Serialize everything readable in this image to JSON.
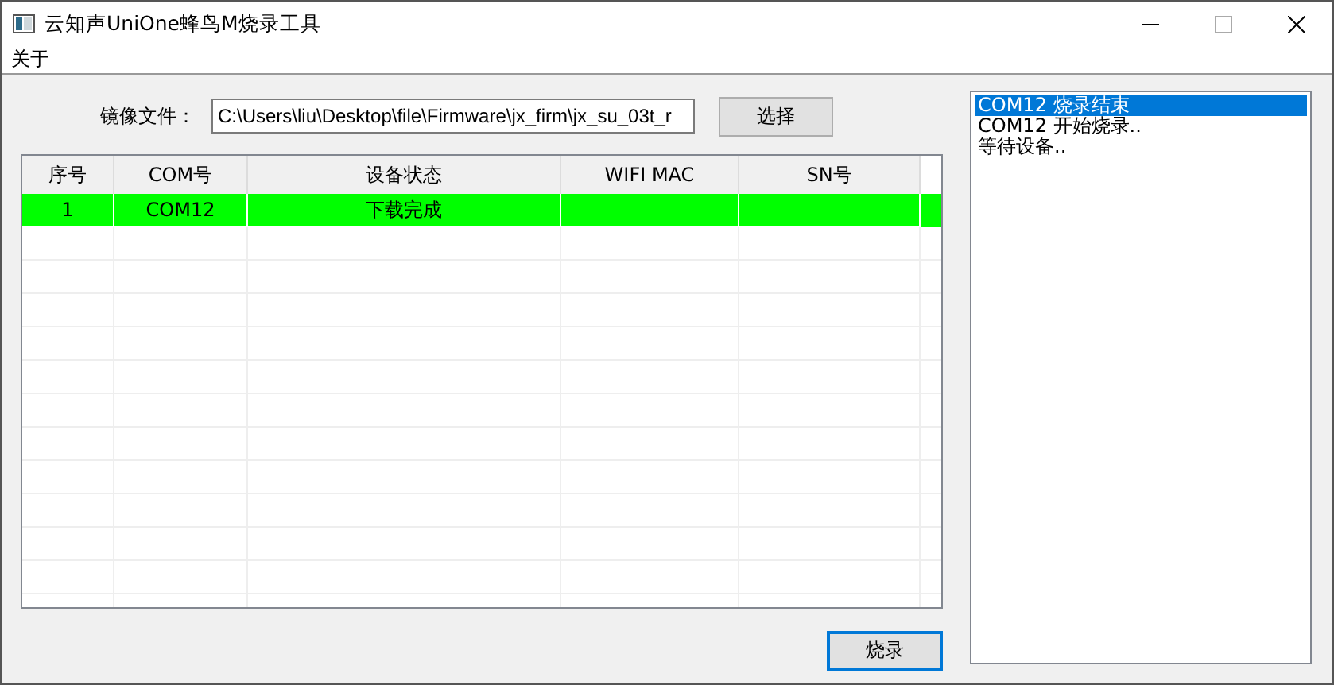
{
  "window": {
    "title": "云知声UniOne蜂鸟M烧录工具"
  },
  "menu": [
    "关于"
  ],
  "image_file": {
    "label": "镜像文件：",
    "value": "C:\\Users\\liu\\Desktop\\file\\Firmware\\jx_firm\\jx_su_03t_r",
    "button": "选择"
  },
  "table": {
    "columns": [
      "序号",
      "COM号",
      "设备状态",
      "WIFI MAC",
      "SN号"
    ],
    "rows": [
      {
        "cells": [
          "1",
          "COM12",
          "下载完成",
          "",
          ""
        ],
        "color": "#00ff00"
      }
    ]
  },
  "burn_button": "烧录",
  "log": [
    {
      "text": "COM12 烧录结束",
      "selected": true
    },
    {
      "text": "COM12 开始烧录..",
      "selected": false
    },
    {
      "text": "等待设备..",
      "selected": false
    }
  ]
}
